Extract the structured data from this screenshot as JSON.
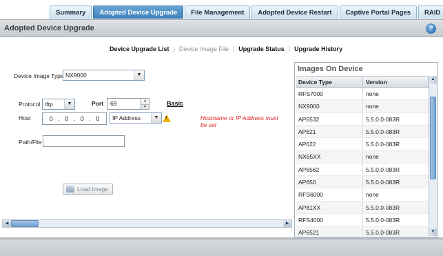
{
  "tabs": [
    {
      "label": "Summary",
      "active": false
    },
    {
      "label": "Adopted Device Upgrade",
      "active": true
    },
    {
      "label": "File Management",
      "active": false
    },
    {
      "label": "Adopted Device Restart",
      "active": false
    },
    {
      "label": "Captive Portal Pages",
      "active": false
    },
    {
      "label": "RAID",
      "active": false
    }
  ],
  "header": {
    "title": "Adopted Device Upgrade",
    "help_icon": "?"
  },
  "subnav": {
    "items": [
      "Device Upgrade List",
      "Device Image File",
      "Upgrade Status",
      "Upgrade History"
    ],
    "separator": "|",
    "active_item": "Device Image File"
  },
  "form": {
    "device_image_type_label": "Device Image Type",
    "device_image_type_value": "NX9000",
    "protocol_label": "Protocol",
    "protocol_value": "tftp",
    "port_label": "Port",
    "port_value": "69",
    "basic_link": "Basic",
    "host_label": "Host",
    "host_ip": [
      "0",
      "0",
      "0",
      "0"
    ],
    "host_type_value": "IP Address",
    "warning_text": "Hostname or IP Address must be set",
    "path_label": "Path/File",
    "path_value": "",
    "load_button": "Load Image"
  },
  "images_panel": {
    "title": "Images On Device",
    "columns": [
      "Device Type",
      "Version"
    ],
    "rows": [
      [
        "RFS7000",
        "none"
      ],
      [
        "NX9000",
        "none"
      ],
      [
        "AP6532",
        "5.5.0.0-083R"
      ],
      [
        "AP621",
        "5.5.0.0-083R"
      ],
      [
        "AP622",
        "5.5.0.0-083R"
      ],
      [
        "NX65XX",
        "none"
      ],
      [
        "AP6562",
        "5.5.0.0-083R"
      ],
      [
        "AP650",
        "5.5.0.0-083R"
      ],
      [
        "RFS6000",
        "none"
      ],
      [
        "AP81XX",
        "5.5.0.0-083R"
      ],
      [
        "RFS4000",
        "5.5.0.0-083R"
      ],
      [
        "AP6521",
        "5.5.0.0-083R"
      ]
    ]
  },
  "colors": {
    "active_tab": "#3d7fb7",
    "warning_text": "#e02020",
    "warning_icon": "#f2b400"
  }
}
